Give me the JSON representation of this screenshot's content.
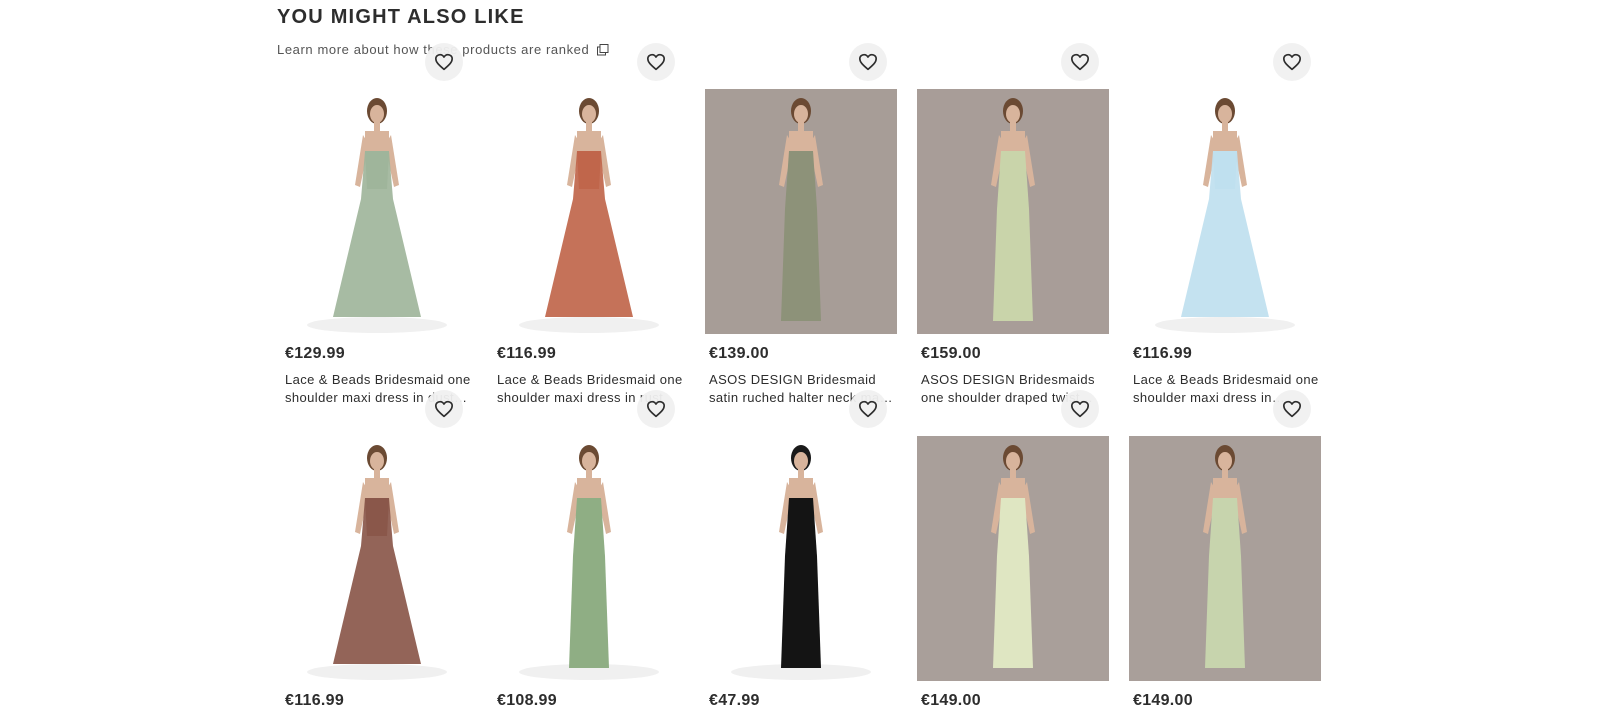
{
  "section": {
    "title": "YOU MIGHT ALSO LIKE",
    "ranked_link": "Learn more about how these products are ranked"
  },
  "products": [
    {
      "price": "€129.99",
      "name": "Lace & Beads Bridesmaid one shoulder maxi dress in dusty sage",
      "dress_color": "#9fb59b",
      "bg": "#ffffff",
      "shape": "gown"
    },
    {
      "price": "€116.99",
      "name": "Lace & Beads Bridesmaid one shoulder maxi dress in rust",
      "dress_color": "#c0664b",
      "bg": "#ffffff",
      "shape": "gown"
    },
    {
      "price": "€139.00",
      "name": "ASOS DESIGN Bridesmaid satin ruched halter neck maxi dress in sage",
      "dress_color": "#8d9279",
      "bg": "#a79d97",
      "shape": "column"
    },
    {
      "price": "€159.00",
      "name": "ASOS DESIGN Bridesmaids one shoulder draped twist maxi dress in sage",
      "dress_color": "#c9d4aa",
      "bg": "#a89d98",
      "shape": "column"
    },
    {
      "price": "€116.99",
      "name": "Lace & Beads Bridesmaid one shoulder maxi dress in powder blue",
      "dress_color": "#bfe0ef",
      "bg": "#ffffff",
      "shape": "gown"
    },
    {
      "price": "€116.99",
      "name": "",
      "dress_color": "#8a574a",
      "bg": "#ffffff",
      "shape": "gown"
    },
    {
      "price": "€108.99",
      "name": "",
      "dress_color": "#8fae84",
      "bg": "#ffffff",
      "shape": "column"
    },
    {
      "price": "€47.99",
      "name": "",
      "dress_color": "#141414",
      "bg": "#ffffff",
      "shape": "column"
    },
    {
      "price": "€149.00",
      "name": "",
      "dress_color": "#dfe6c2",
      "bg": "#a99f9a",
      "shape": "column"
    },
    {
      "price": "€149.00",
      "name": "",
      "dress_color": "#c7d4ad",
      "bg": "#a99f9a",
      "shape": "column"
    }
  ]
}
